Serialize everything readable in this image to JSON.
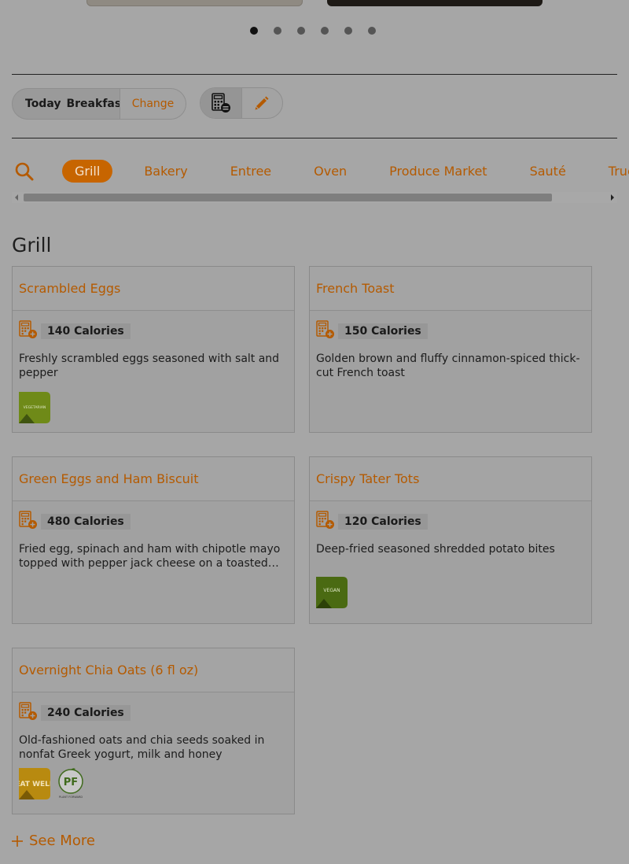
{
  "carousel": {
    "page_count": 6,
    "active_index": 0
  },
  "meal_selector": {
    "day": "Today",
    "meal": "Breakfast",
    "change_label": "Change"
  },
  "stations": {
    "tabs": [
      {
        "label": "Grill",
        "active": true
      },
      {
        "label": "Bakery"
      },
      {
        "label": "Entree"
      },
      {
        "label": "Oven"
      },
      {
        "label": "Produce Market"
      },
      {
        "label": "Sauté"
      },
      {
        "label": "Truck"
      }
    ]
  },
  "section": {
    "title": "Grill"
  },
  "items": [
    {
      "name": "Scrambled Eggs",
      "calories": "140 Calories",
      "description": "Freshly scrambled eggs seasoned with salt and pepper",
      "badges": [
        {
          "type": "vegetarian",
          "label": "VEGETARIAN",
          "color": "#6f8a18"
        }
      ]
    },
    {
      "name": "French Toast",
      "calories": "150 Calories",
      "description": "Golden brown and fluffy cinnamon-spiced thick-cut French toast",
      "badges": []
    },
    {
      "name": "Green Eggs and Ham Biscuit",
      "calories": "480 Calories",
      "description": "Fried egg, spinach and ham with chipotle mayo topped with pepper jack cheese on a toasted…",
      "badges": []
    },
    {
      "name": "Crispy Tater Tots",
      "calories": "120 Calories",
      "description": "Deep-fried seasoned shredded potato bites",
      "badges": [
        {
          "type": "vegan",
          "label": "VEGAN",
          "color": "#4a6a12"
        }
      ]
    },
    {
      "name": "Overnight Chia Oats (6 fl oz)",
      "calories": "240 Calories",
      "description": "Old-fashioned oats and chia seeds soaked in nonfat Greek yogurt, milk and honey",
      "badges": [
        {
          "type": "eat-well",
          "label": "EAT WELL",
          "color": "#b88a10"
        },
        {
          "type": "plant-forward",
          "label": "PF",
          "sub": "PLANT FORWARD",
          "color": "#3f6a1c"
        }
      ]
    }
  ],
  "see_more": {
    "label": "See More"
  },
  "colors": {
    "accent": "#b45a00",
    "active_tab": "#c76500",
    "overlay_bg": "#a6a6a6"
  }
}
